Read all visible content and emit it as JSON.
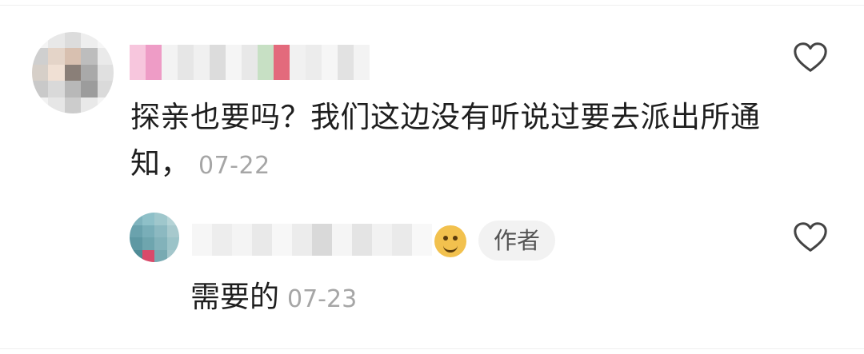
{
  "comment": {
    "text": "探亲也要吗？我们这边没有听说过要去派出所通知，",
    "date": "07-22",
    "like_icon": "heart-outline-icon",
    "avatar_colors": [
      "#f4f4f4",
      "#e8e8e8",
      "#dcdcdc",
      "#eeeeee",
      "#f6f6f6",
      "#cfcfcf",
      "#e4d4c8",
      "#d8c0b0",
      "#bdbdbd",
      "#eaeaea",
      "#d6cfc8",
      "#f0e0d4",
      "#8a7f78",
      "#a9a9a9",
      "#e0e0e0",
      "#c9c9c9",
      "#d9d9d9",
      "#b8b8b8",
      "#9c9c9c",
      "#dadada",
      "#f2f2f2",
      "#e6e6e6",
      "#cccccc",
      "#e9e9e9",
      "#f5f5f5"
    ],
    "name_colors": [
      "#f7c6dd",
      "#ee9cc6",
      "#f3f3f3",
      "#e6e6e6",
      "#f0f0f0",
      "#dcdcdc",
      "#f5f5f5",
      "#e8e8e8",
      "#c7e0c4",
      "#e36a7c",
      "#f1f1f1",
      "#ececec",
      "#f6f6f6",
      "#e2e2e2",
      "#f3f3f3"
    ]
  },
  "reply": {
    "author_badge": "作者",
    "text": "需要的",
    "date": "07-23",
    "like_icon": "heart-outline-icon",
    "emoji_icon": "cat-face-icon",
    "avatar_colors": [
      "#7fb3bd",
      "#8ec0c8",
      "#9fc7cc",
      "#b5d3d6",
      "#6aa2ad",
      "#79aeb8",
      "#8cb9c1",
      "#a7c9cd",
      "#5e98a3",
      "#6ea5ae",
      "#82b2ba",
      "#9bc3c8",
      "#4f8b96",
      "#d94a6a",
      "#78aab2",
      "#a3c6cb"
    ],
    "name_colors": [
      "#f6f6f6",
      "#ededed",
      "#f4f4f4",
      "#e9e9e9",
      "#f7f7f7",
      "#ececec",
      "#d9d9d9",
      "#f5f5f5",
      "#e4e4e4",
      "#f2f2f2",
      "#eaeaea",
      "#f8f8f8"
    ]
  }
}
